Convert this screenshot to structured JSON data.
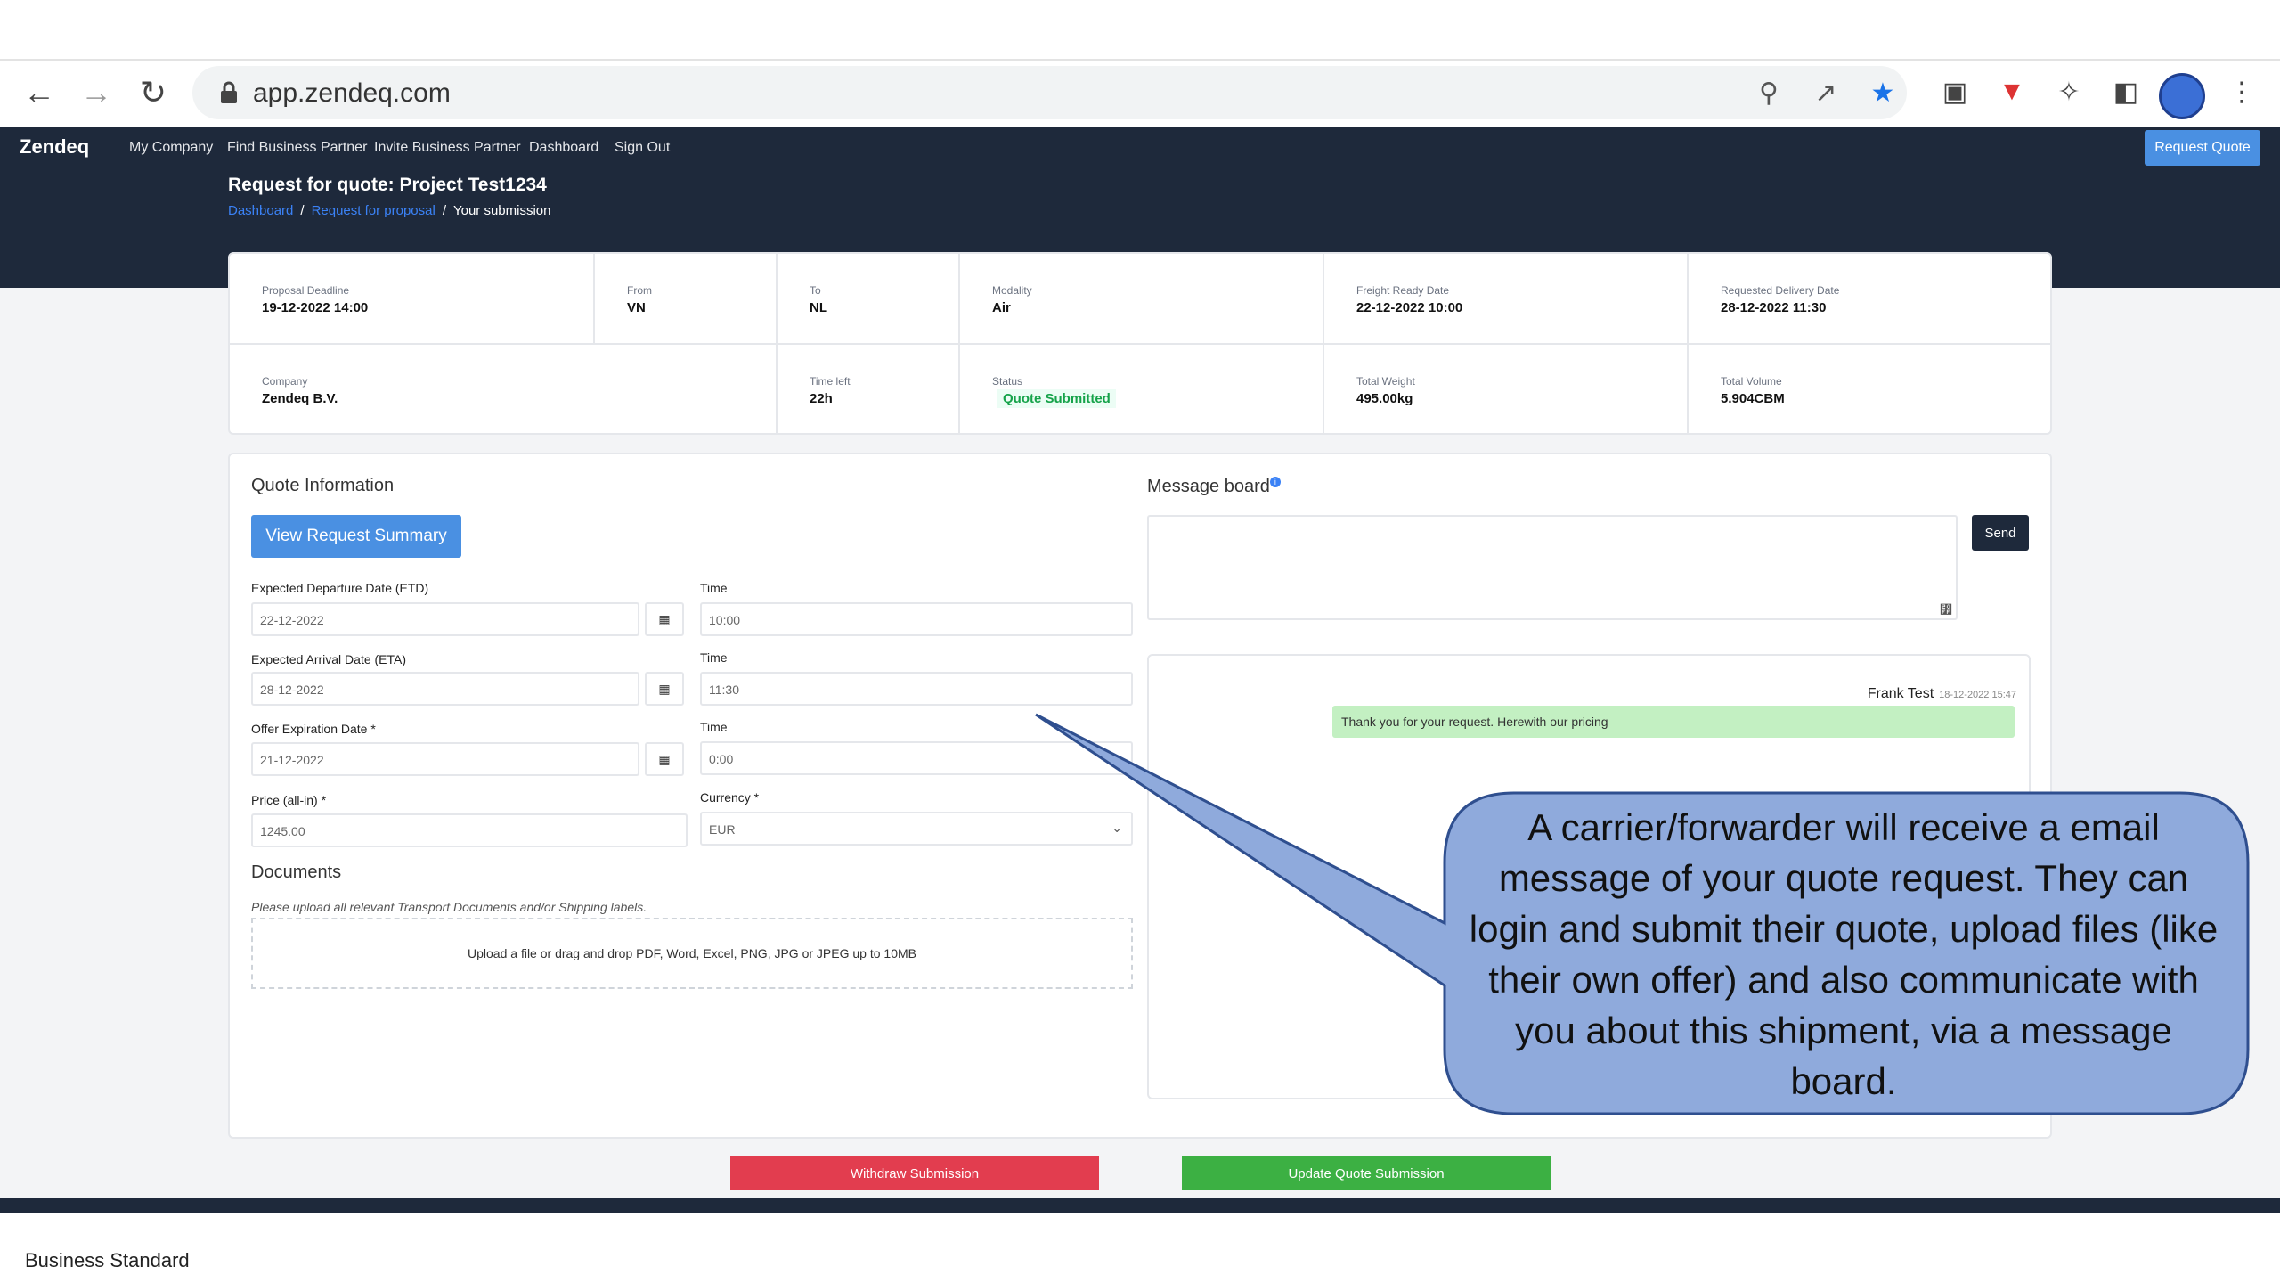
{
  "browser": {
    "url": "app.zendeq.com"
  },
  "nav": {
    "brand": "Zendeq",
    "links": [
      "My Company",
      "Find Business Partner",
      "Invite Business Partner",
      "Dashboard",
      "Sign Out"
    ],
    "request_quote": "Request Quote"
  },
  "header": {
    "title": "Request for quote: Project Test1234",
    "breadcrumb": [
      "Dashboard",
      "Request for proposal",
      "Your submission"
    ],
    "separator": "/"
  },
  "summary": {
    "proposal_deadline": {
      "label": "Proposal Deadline",
      "value": "19-12-2022 14:00"
    },
    "from": {
      "label": "From",
      "value": "VN"
    },
    "to": {
      "label": "To",
      "value": "NL"
    },
    "modality": {
      "label": "Modality",
      "value": "Air"
    },
    "freight_ready": {
      "label": "Freight Ready Date",
      "value": "22-12-2022 10:00"
    },
    "requested_delivery": {
      "label": "Requested Delivery Date",
      "value": "28-12-2022 11:30"
    },
    "company": {
      "label": "Company",
      "value": "Zendeq B.V."
    },
    "time_left": {
      "label": "Time left",
      "value": "22h"
    },
    "status": {
      "label": "Status",
      "value": "Quote Submitted"
    },
    "total_weight": {
      "label": "Total Weight",
      "value": "495.00kg"
    },
    "total_volume": {
      "label": "Total Volume",
      "value": "5.904CBM"
    }
  },
  "quote": {
    "heading": "Quote Information",
    "view_summary": "View Request Summary",
    "etd": {
      "label": "Expected Departure Date (ETD)",
      "value": "22-12-2022",
      "time_label": "Time",
      "time": "10:00"
    },
    "eta": {
      "label": "Expected Arrival Date (ETA)",
      "value": "28-12-2022",
      "time_label": "Time",
      "time": "11:30"
    },
    "expiry": {
      "label": "Offer Expiration Date *",
      "value": "21-12-2022",
      "time_label": "Time",
      "time": "0:00"
    },
    "price": {
      "label": "Price (all-in) *",
      "value": "1245.00"
    },
    "currency": {
      "label": "Currency *",
      "value": "EUR"
    },
    "documents": {
      "heading": "Documents",
      "hint": "Please upload all relevant Transport Documents and/or Shipping labels.",
      "dropzone": "Upload a file or drag and drop PDF, Word, Excel, PNG, JPG or JPEG up to 10MB"
    }
  },
  "messages": {
    "heading": "Message board",
    "send": "Send",
    "items": [
      {
        "author": "Frank Test",
        "timestamp": "18-12-2022 15:47",
        "text": "Thank you for your request. Herewith our pricing"
      }
    ]
  },
  "actions": {
    "withdraw": "Withdraw Submission",
    "update": "Update Quote Submission"
  },
  "callout": {
    "text": "A carrier/forwarder will receive a email message of your quote request. They can login and submit their quote, upload files (like their own offer) and also communicate with you about this shipment, via a message board."
  },
  "footer": {
    "text": "Business Standard"
  },
  "colors": {
    "navbar": "#1e293b",
    "primary": "#4a90e2",
    "danger": "#e23d4f",
    "success": "#3cb043",
    "callout_fill": "#8faadc",
    "callout_border": "#2f4f8f"
  }
}
